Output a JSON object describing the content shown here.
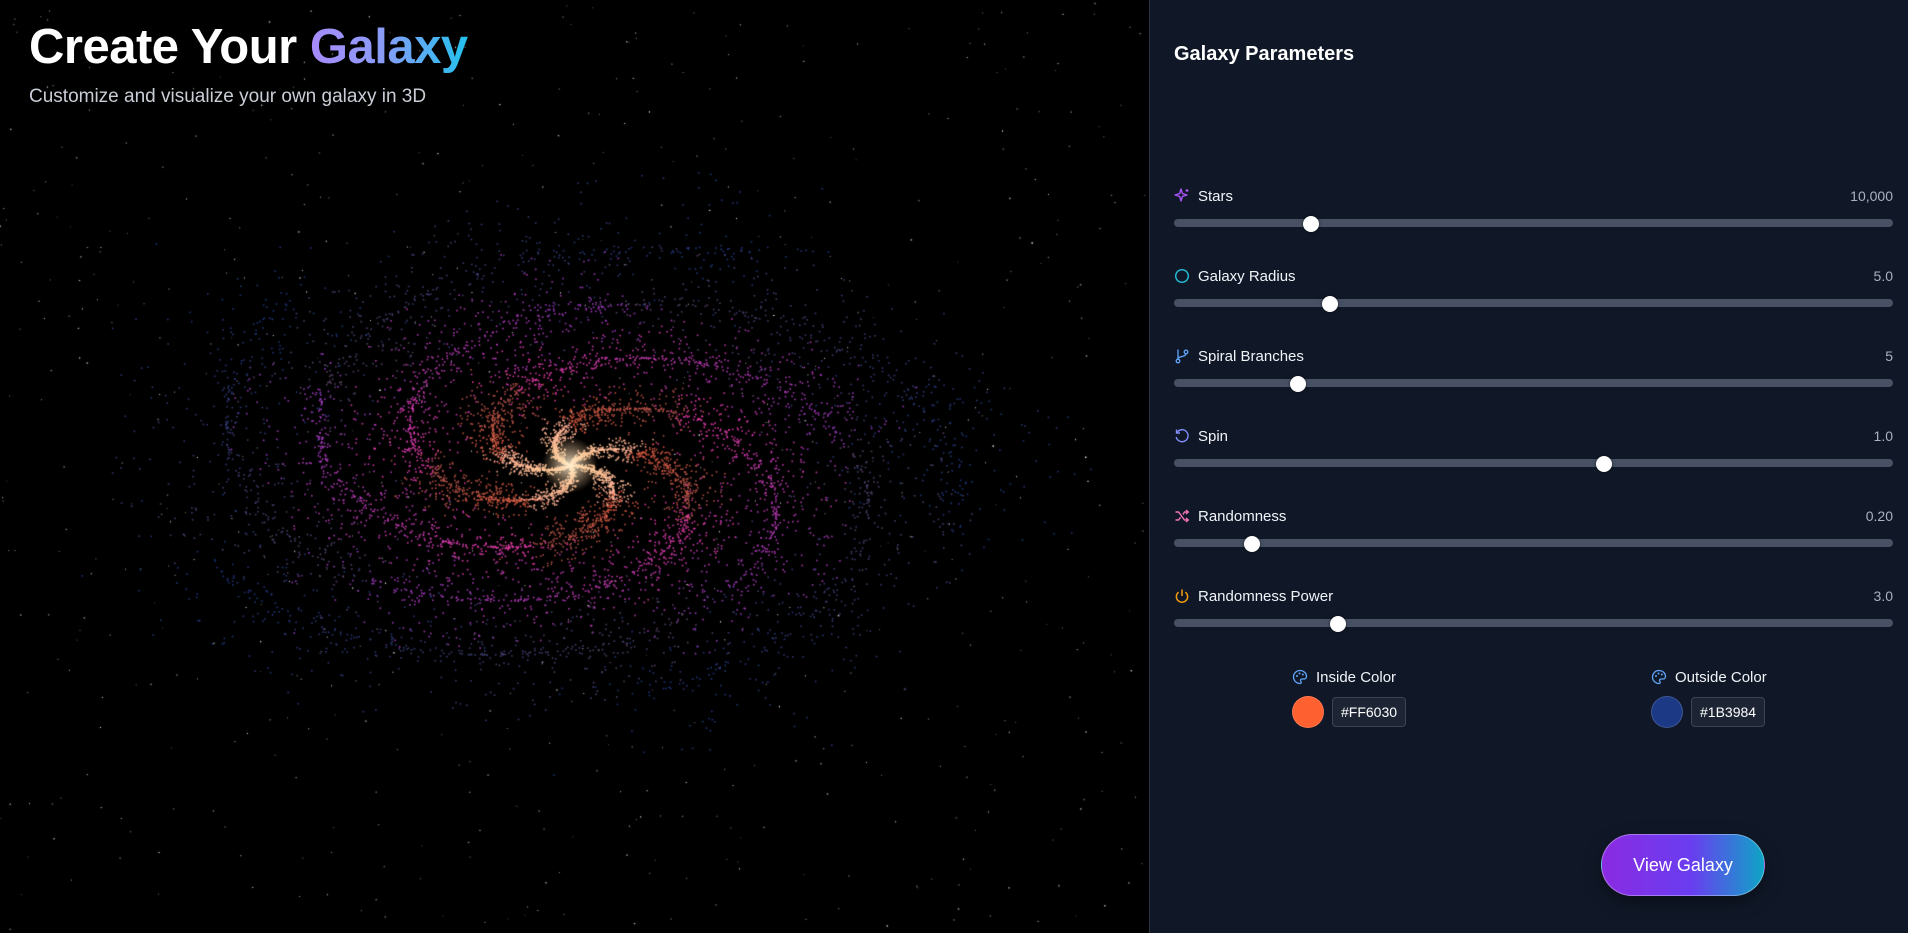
{
  "hero": {
    "title_prefix": "Create Your ",
    "title_accent": "Galaxy",
    "subtitle": "Customize and visualize your own galaxy in 3D"
  },
  "panel": {
    "title": "Galaxy Parameters",
    "params": [
      {
        "label": "Stars",
        "value": "10,000",
        "level": 0.19,
        "icon": "sparkles-icon",
        "icon_color": "#a855f7"
      },
      {
        "label": "Galaxy Radius",
        "value": "5.0",
        "level": 0.217,
        "icon": "circle-icon",
        "icon_color": "#22b8cf"
      },
      {
        "label": "Spiral Branches",
        "value": "5",
        "level": 0.173,
        "icon": "git-branch-icon",
        "icon_color": "#60a5fa"
      },
      {
        "label": "Spin",
        "value": "1.0",
        "level": 0.598,
        "icon": "rotate-icon",
        "icon_color": "#818cf8"
      },
      {
        "label": "Randomness",
        "value": "0.20",
        "level": 0.108,
        "icon": "shuffle-icon",
        "icon_color": "#f472b6"
      },
      {
        "label": "Randomness Power",
        "value": "3.0",
        "level": 0.228,
        "icon": "power-icon",
        "icon_color": "#f59e0b"
      }
    ],
    "inside_color": {
      "label": "Inside Color",
      "hex": "#FF6030"
    },
    "outside_color": {
      "label": "Outside Color",
      "hex": "#1B3984"
    },
    "view_button": "View Galaxy"
  }
}
